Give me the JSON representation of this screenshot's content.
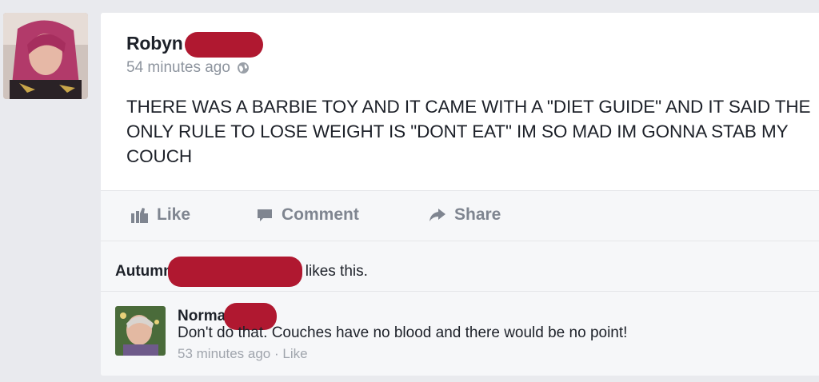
{
  "post": {
    "author_name": "Robyn",
    "timestamp": "54 minutes ago",
    "privacy_icon": "globe-icon",
    "text": "THERE WAS A BARBIE TOY AND IT CAME WITH A \"DIET GUIDE\" AND IT SAID THE ONLY RULE TO LOSE WEIGHT IS \"DONT EAT\" IM SO MAD IM GONNA STAB MY COUCH"
  },
  "actions": {
    "like_label": "Like",
    "comment_label": "Comment",
    "share_label": "Share"
  },
  "likes": {
    "name": "Autumn",
    "suffix": "likes this."
  },
  "comment": {
    "author_name": "Norma",
    "text": "Don't do that.  Couches have no blood and there would be no point!",
    "timestamp": "53 minutes ago",
    "separator": " · ",
    "like_label": "Like"
  },
  "colors": {
    "redaction": "#b01830",
    "text": "#1d2129",
    "muted": "#8d949e",
    "background": "#e9eaee"
  }
}
